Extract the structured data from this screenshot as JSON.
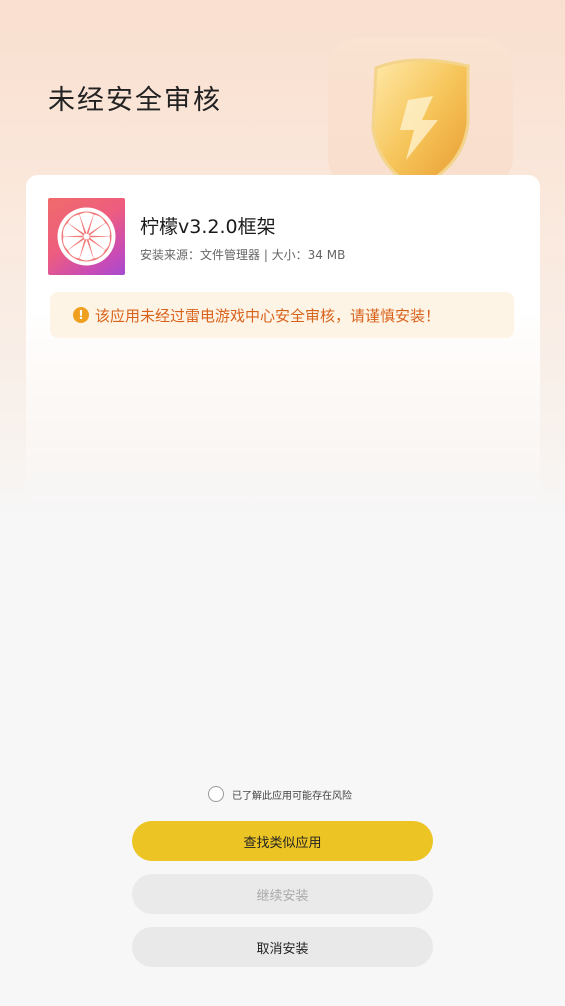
{
  "header": {
    "title": "未经安全审核"
  },
  "app": {
    "name": "柠檬v3.2.0框架",
    "meta": "安装来源：文件管理器 | 大小：34 MB",
    "icon": "lemon-slice-icon"
  },
  "warning": {
    "icon": "exclamation-circle-icon",
    "text": "该应用未经过雷电游戏中心安全审核，请谨慎安装！"
  },
  "risk_ack": {
    "label": "已了解此应用可能存在风险",
    "checked": false
  },
  "buttons": {
    "find_similar": "查找类似应用",
    "continue_install": "继续安装",
    "cancel_install": "取消安装"
  },
  "colors": {
    "primary": "#ecc424",
    "warning_text": "#d9621b",
    "warning_bg": "#fdf4e6"
  }
}
